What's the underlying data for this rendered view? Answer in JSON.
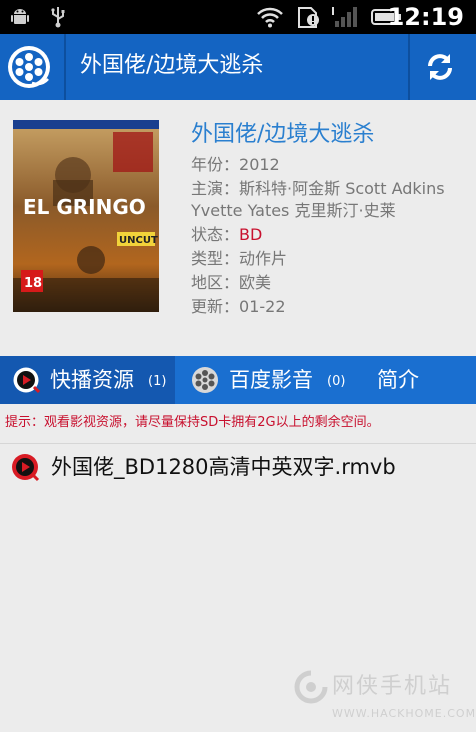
{
  "statusbar": {
    "time": "12:19"
  },
  "header": {
    "title": "外国佬/边境大逃杀"
  },
  "movie": {
    "poster_title": "EL GRINGO",
    "poster_badge_uncut": "UNCUT",
    "poster_badge_rating": "18",
    "name": "外国佬/边境大逃杀",
    "year_label": "年份：",
    "year": "2012",
    "cast_label": "主演：",
    "cast": "斯科特·阿金斯 Scott Adkins Yvette Yates 克里斯汀·史莱",
    "status_label": "状态：",
    "status": "BD",
    "genre_label": "类型：",
    "genre": "动作片",
    "region_label": "地区：",
    "region": "欧美",
    "update_label": "更新：",
    "update": "01-22"
  },
  "tabs": [
    {
      "label": "快播资源",
      "count": "(1)"
    },
    {
      "label": "百度影音",
      "count": "(0)"
    },
    {
      "label": "简介"
    }
  ],
  "hint": "提示：观看影视资源，请尽量保持SD卡拥有2G以上的剩余空间。",
  "files": [
    {
      "name": "外国佬_BD1280高清中英双字.rmvb"
    }
  ],
  "watermark": {
    "text": "网侠手机站",
    "url": "WWW.HACKHOME.COM"
  },
  "colors": {
    "accent": "#1464c2",
    "link": "#2a7fcf",
    "warning": "#c8102e",
    "tab_active": "#1458b0"
  }
}
